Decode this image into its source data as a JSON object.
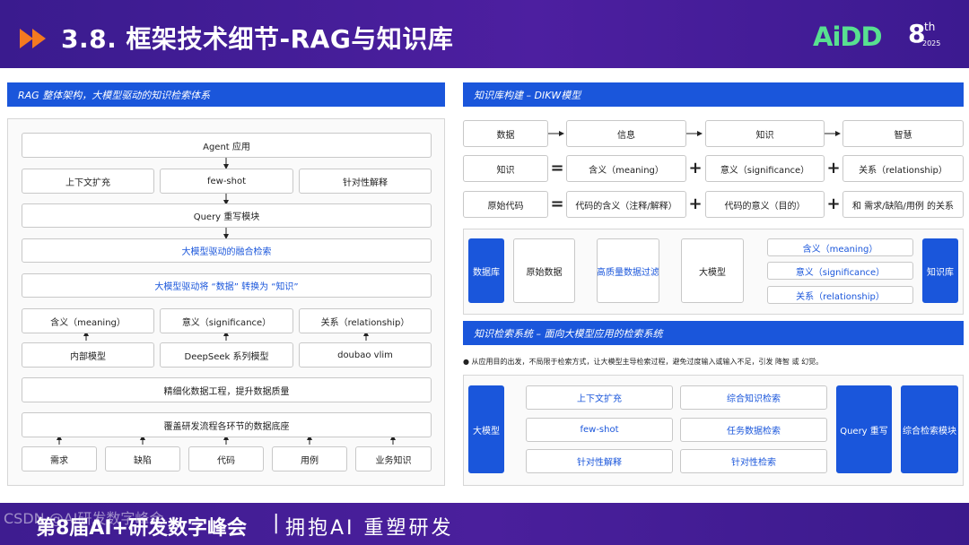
{
  "header": {
    "title": "3.8. 框架技术细节-RAG与知识库",
    "logo_text": "AiDD",
    "logo_num": "8",
    "logo_th": "th",
    "logo_year": "2025",
    "bg_color": "#3a1b8e",
    "accent_color": "#f47a20",
    "logo_color": "#58e090"
  },
  "left": {
    "header": "RAG 整体架构，大模型驱动的知识检索体系",
    "agent": "Agent 应用",
    "context": "上下文扩充",
    "fewshot": "few-shot",
    "targeted": "针对性解释",
    "query": "Query 重写模块",
    "fusion": "大模型驱动的融合检索",
    "transform": "大模型驱动将 “数据” 转换为 “知识”",
    "meaning": "含义（meaning）",
    "significance": "意义（significance）",
    "relationship": "关系（relationship）",
    "internal": "内部模型",
    "deepseek": "DeepSeek 系列模型",
    "doubao": "doubao vlim",
    "refine": "精细化数据工程，提升数据质量",
    "cover": "覆盖研发流程各环节的数据底座",
    "bottom": [
      "需求",
      "缺陷",
      "代码",
      "用例",
      "业务知识"
    ]
  },
  "right": {
    "dikw_header": "知识库构建 – DIKW模型",
    "dikw": [
      "数据",
      "信息",
      "知识",
      "智慧"
    ],
    "row2": {
      "a": "知识",
      "eq": "=",
      "b": "含义（meaning）",
      "plus1": "+",
      "c": "意义（significance）",
      "plus2": "+",
      "d": "关系（relationship）"
    },
    "row3": {
      "a": "原始代码",
      "eq": "=",
      "b": "代码的含义（注释/解释）",
      "plus1": "+",
      "c": "代码的意义（目的）",
      "plus2": "+",
      "d": "和 需求/缺陷/用例 的关系"
    },
    "flow": {
      "db": "数据库",
      "raw": "原始数据",
      "filter": "高质量数据过滤",
      "llm": "大模型",
      "meaning": "含义（meaning）",
      "significance": "意义（significance）",
      "relationship": "关系（relationship）",
      "kb": "知识库"
    },
    "retr_header": "知识检索系统 – 面向大模型应用的检索系统",
    "bullet": "● 从应用目的出发，不局限于检索方式，让大模型主导检索过程，避免过度输入或输入不足，引发 降智 或 幻觉。",
    "retr": {
      "llm": "大模型",
      "context": "上下文扩充",
      "fewshot": "few-shot",
      "targeted": "针对性解释",
      "comp_know": "综合知识检索",
      "task_data": "任务数据检索",
      "targeted_retr": "针对性检索",
      "query": "Query 重写",
      "comp_module": "综合检索模块"
    }
  },
  "footer": {
    "text": "第8届AI+研发数字峰会",
    "sep": "|",
    "slogan": "拥抱AI 重塑研发",
    "watermark": "CSDN @AI研发数字峰会"
  }
}
